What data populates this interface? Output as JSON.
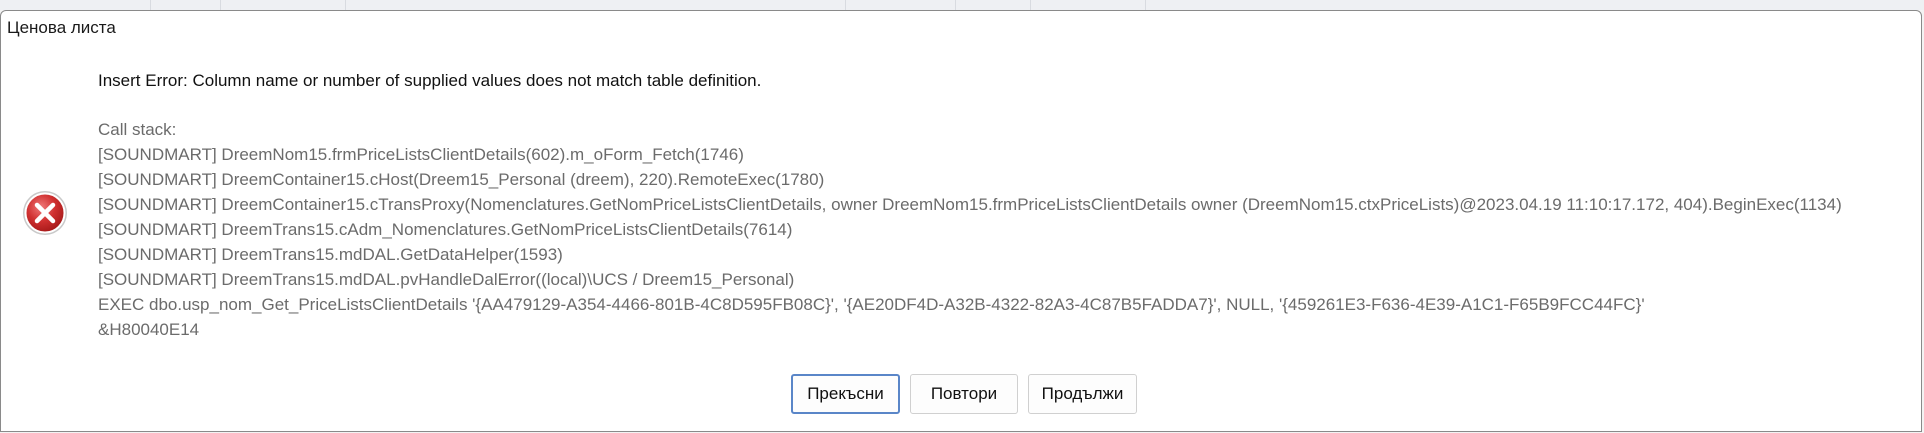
{
  "window": {
    "title": "Ценова листа"
  },
  "message": "Insert Error: Column name or number of supplied values does not match table definition.",
  "callstack": {
    "heading": "Call stack:",
    "lines": [
      "[SOUNDMART] DreemNom15.frmPriceListsClientDetails(602).m_oForm_Fetch(1746)",
      "[SOUNDMART] DreemContainer15.cHost(Dreem15_Personal (dreem), 220).RemoteExec(1780)",
      "[SOUNDMART] DreemContainer15.cTransProxy(Nomenclatures.GetNomPriceListsClientDetails, owner DreemNom15.frmPriceListsClientDetails owner (DreemNom15.ctxPriceLists)@2023.04.19 11:10:17.172, 404).BeginExec(1134)",
      "[SOUNDMART] DreemTrans15.cAdm_Nomenclatures.GetNomPriceListsClientDetails(7614)",
      "[SOUNDMART] DreemTrans15.mdDAL.GetDataHelper(1593)",
      "[SOUNDMART] DreemTrans15.mdDAL.pvHandleDalError((local)\\UCS / Dreem15_Personal)",
      "EXEC dbo.usp_nom_Get_PriceListsClientDetails '{AA479129-A354-4466-801B-4C8D595FB08C}', '{AE20DF4D-A32B-4322-82A3-4C87B5FADDA7}', NULL, '{459261E3-F636-4E39-A1C1-F65B9FCC44FC}'",
      "&H80040E14"
    ]
  },
  "buttons": {
    "abort": "Прекъсни",
    "retry": "Повтори",
    "continue": "Продължи"
  },
  "icons": {
    "error": "error-icon",
    "close": "close-icon"
  },
  "colors": {
    "error_red": "#d03030",
    "focus_border": "#5a86c8"
  }
}
